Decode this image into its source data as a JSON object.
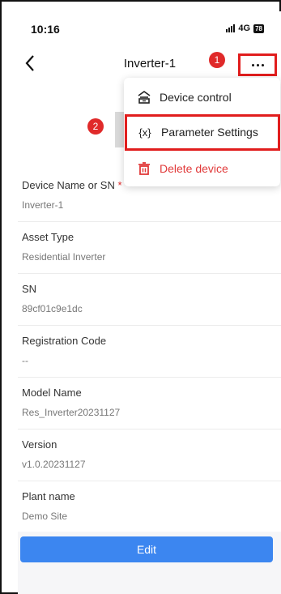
{
  "status": {
    "time": "10:16",
    "network": "4G",
    "battery": "78"
  },
  "nav": {
    "title": "Inverter-1"
  },
  "annotations": {
    "step1": "1",
    "step2": "2"
  },
  "menu": {
    "items": [
      {
        "label": "Device control",
        "icon": "device-control-icon"
      },
      {
        "label": "Parameter Settings",
        "icon": "variable-braces-icon"
      },
      {
        "label": "Delete device",
        "icon": "trash-icon",
        "color": "#e13a3a"
      }
    ]
  },
  "details": [
    {
      "label": "Device Name or SN",
      "required": "*",
      "value": "Inverter-1"
    },
    {
      "label": "Asset Type",
      "value": "Residential Inverter"
    },
    {
      "label": "SN",
      "value": "89cf01c9e1dc"
    },
    {
      "label": "Registration Code",
      "value": "--"
    },
    {
      "label": "Model Name",
      "value": "Res_Inverter20231127"
    },
    {
      "label": "Version",
      "value": "v1.0.20231127"
    },
    {
      "label": "Plant name",
      "value": "Demo Site"
    }
  ],
  "footer": {
    "edit_label": "Edit"
  },
  "colors": {
    "accent": "#3c86f0",
    "danger": "#e13a3a",
    "highlight": "#e11d1d"
  }
}
